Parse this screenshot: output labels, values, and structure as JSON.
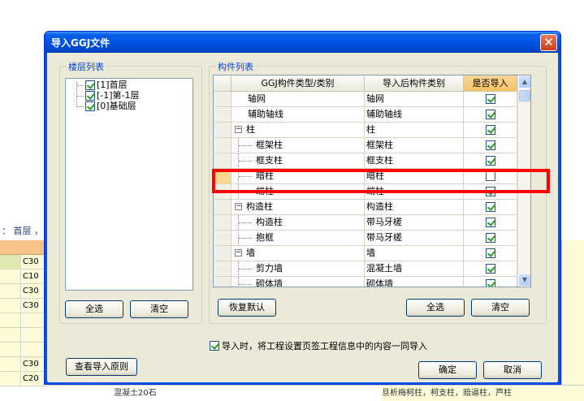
{
  "background": {
    "breadcrumb": "： 首层 ， C",
    "grid_values": [
      "C30",
      "C10",
      "C30",
      "C30",
      "",
      "",
      "",
      "C30",
      "C20"
    ],
    "bottom_text_1": "混凝土20石",
    "bottom_text_2": "混凝土20石",
    "bottom_text_3": "旦析梅柯柱，柯支柱，赔逼柱，芦柱"
  },
  "dialog": {
    "title": "导入GGJ文件",
    "close_label": "✕",
    "floor_group": {
      "legend": "楼层列表",
      "items": [
        {
          "label": "[1]首层",
          "checked": true
        },
        {
          "label": "[-1]第-1层",
          "checked": true
        },
        {
          "label": "[0]基础层",
          "checked": true
        }
      ],
      "select_all_label": "全选",
      "clear_label": "清空"
    },
    "component_group": {
      "legend": "构件列表",
      "columns": [
        "GGJ构件类型/类别",
        "导入后构件类别",
        "是否导入"
      ],
      "rows": [
        {
          "name": "轴网",
          "after": "轴网",
          "import": true,
          "level": 0,
          "expander": ""
        },
        {
          "name": "辅助轴线",
          "after": "辅助轴线",
          "import": true,
          "level": 0,
          "expander": ""
        },
        {
          "name": "柱",
          "after": "柱",
          "import": true,
          "level": 0,
          "expander": "−"
        },
        {
          "name": "框架柱",
          "after": "框架柱",
          "import": true,
          "level": 1,
          "expander": ""
        },
        {
          "name": "框支柱",
          "after": "框支柱",
          "import": true,
          "level": 1,
          "expander": ""
        },
        {
          "name": "暗柱",
          "after": "暗柱",
          "import": false,
          "level": 1,
          "expander": "",
          "selected": true
        },
        {
          "name": "端柱",
          "after": "端柱",
          "import": true,
          "level": 1,
          "expander": ""
        },
        {
          "name": "构造柱",
          "after": "构造柱",
          "import": true,
          "level": 0,
          "expander": "−"
        },
        {
          "name": "构造柱",
          "after": "带马牙槎",
          "import": true,
          "level": 1,
          "expander": ""
        },
        {
          "name": "抱框",
          "after": "带马牙槎",
          "import": true,
          "level": 1,
          "expander": ""
        },
        {
          "name": "墙",
          "after": "墙",
          "import": true,
          "level": 0,
          "expander": "−"
        },
        {
          "name": "剪力墙",
          "after": "混凝土墙",
          "import": true,
          "level": 1,
          "expander": ""
        },
        {
          "name": "砌体墙",
          "after": "砌体墙",
          "import": true,
          "level": 1,
          "expander": ""
        }
      ],
      "restore_default_label": "恢复默认",
      "select_all_label": "全选",
      "clear_label": "清空"
    },
    "import_option": {
      "checked": true,
      "label": "导入时，将工程设置页签工程信息中的内容一同导入"
    },
    "view_rules_label": "查看导入原则",
    "ok_label": "确定",
    "cancel_label": "取消"
  },
  "colors": {
    "title_bar": "#0054e3",
    "highlight_box": "#ff0000",
    "legend_text": "#0046d5",
    "import_header": "#f6c160"
  }
}
